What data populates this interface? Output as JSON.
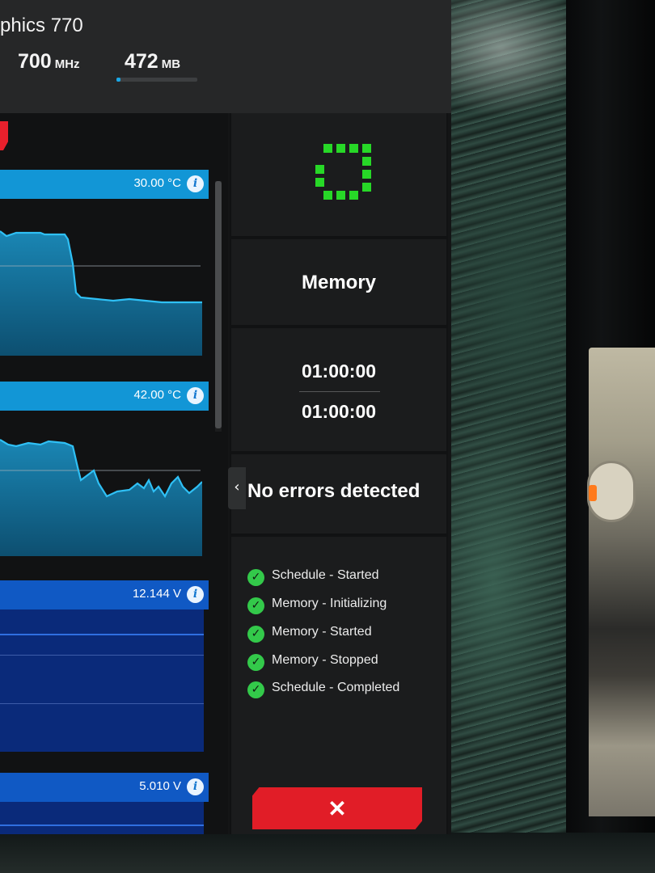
{
  "header": {
    "gpu_name": "phics 770",
    "clock": {
      "value": "700",
      "unit": "MHz"
    },
    "memory": {
      "value": "472",
      "unit": "MB",
      "usage_fraction": 0.05
    }
  },
  "sensors": [
    {
      "value": "30.00 °C",
      "info_icon": "i"
    },
    {
      "value": "42.00 °C",
      "info_icon": "i"
    },
    {
      "value": "12.144 V",
      "info_icon": "i"
    },
    {
      "value": "5.010 V",
      "info_icon": "i"
    }
  ],
  "status": {
    "test_name": "Memory",
    "time_elapsed": "01:00:00",
    "time_total": "01:00:00",
    "result": "No errors detected",
    "collapse_glyph": "‹",
    "log": [
      {
        "icon": "check-circle-icon",
        "text": "Schedule - Started"
      },
      {
        "icon": "check-circle-icon",
        "text": "Memory - Initializing"
      },
      {
        "icon": "check-circle-icon",
        "text": "Memory - Started"
      },
      {
        "icon": "check-circle-icon",
        "text": "Memory - Stopped"
      },
      {
        "icon": "check-circle-icon",
        "text": "Schedule - Completed"
      }
    ],
    "check_glyph": "✓",
    "cancel_glyph": "✕"
  },
  "colors": {
    "accent_blue": "#1296d6",
    "voltage_blue": "#1059c4",
    "success_green": "#27d827",
    "cancel_red": "#e11d27"
  }
}
